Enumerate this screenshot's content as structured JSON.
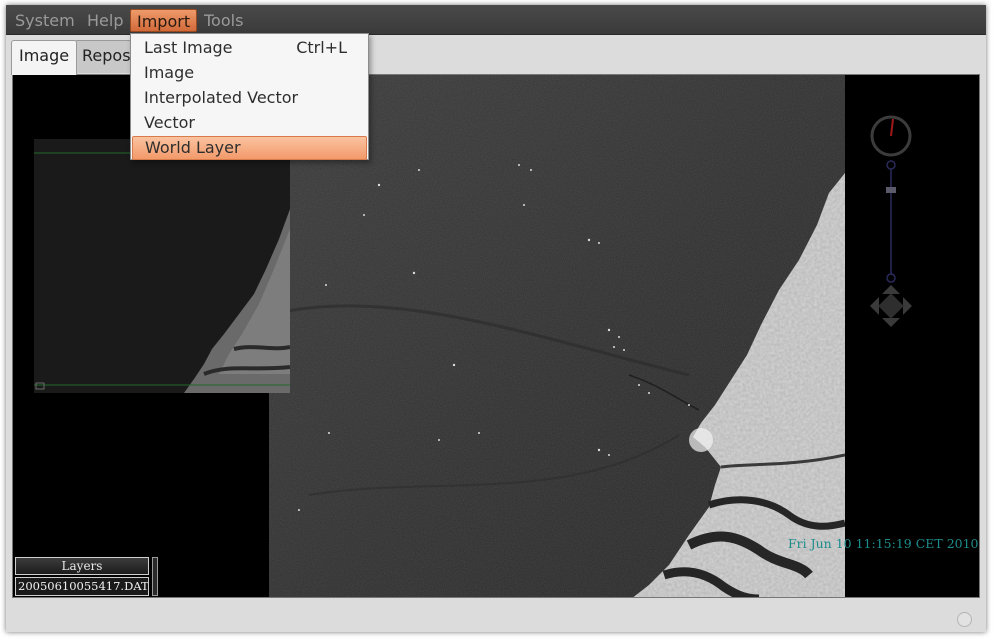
{
  "menubar": {
    "items": [
      {
        "label": "System"
      },
      {
        "label": "Help"
      },
      {
        "label": "Import"
      },
      {
        "label": "Tools"
      }
    ],
    "active_color": "#e07a46"
  },
  "tabs": [
    {
      "label": "Image",
      "selected": true
    },
    {
      "label": "Reposi",
      "selected": false
    }
  ],
  "dropdown": {
    "items": [
      {
        "label": "Last Image",
        "shortcut": "Ctrl+L"
      },
      {
        "label": "Image",
        "shortcut": ""
      },
      {
        "label": "Interpolated Vector",
        "shortcut": ""
      },
      {
        "label": "Vector",
        "shortcut": ""
      },
      {
        "label": "World Layer",
        "shortcut": "",
        "highlighted": true
      }
    ]
  },
  "layers": {
    "title": "Layers",
    "items": [
      "20050610055417.DAT"
    ]
  },
  "viewer": {
    "timestamp": "Fri Jun 10 11:15:19 CET 2010",
    "icons": [
      "compass-icon",
      "zoom-slider",
      "pan-arrows-icon"
    ]
  },
  "colors": {
    "menubar": "#3e3e3e",
    "accent": "#e07a46",
    "timestamp": "#1e8c8c"
  }
}
